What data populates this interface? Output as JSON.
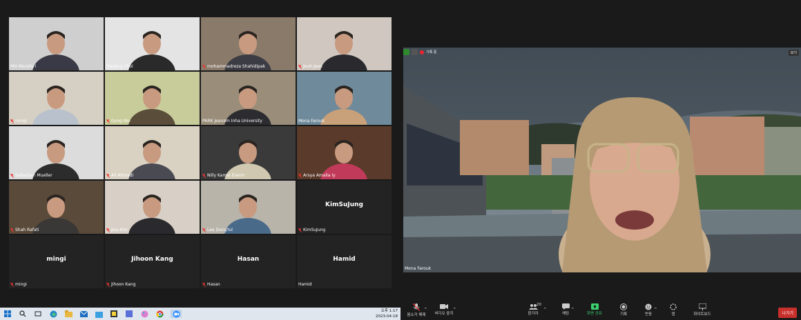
{
  "gallery": {
    "tiles": [
      {
        "name": "MH Mozafari",
        "type": "video",
        "muted": false
      },
      {
        "name": "Yunjong Choi",
        "type": "video",
        "muted": false
      },
      {
        "name": "mohammadreza Shahidipak",
        "type": "video",
        "muted": true
      },
      {
        "name": "Jeuh Jeon",
        "type": "video",
        "muted": true
      },
      {
        "name": "mingi",
        "type": "video",
        "muted": true
      },
      {
        "name": "Gong Nio",
        "type": "video",
        "muted": true
      },
      {
        "name": "PARK Jeanam Inha University",
        "type": "video",
        "muted": false
      },
      {
        "name": "Mona Farouk",
        "type": "video",
        "muted": false,
        "active": true
      },
      {
        "name": "Sebastian Mueller",
        "type": "video",
        "muted": true
      },
      {
        "name": "Ali Ahmadi",
        "type": "video",
        "muted": true
      },
      {
        "name": "Nilly Kamal Elamir",
        "type": "video",
        "muted": true
      },
      {
        "name": "Arsya Amalia Iy",
        "type": "video",
        "muted": true
      },
      {
        "name": "Shah Rafati",
        "type": "video",
        "muted": true
      },
      {
        "name": "Jisu Kim",
        "type": "video",
        "muted": true
      },
      {
        "name": "Lee DongYul",
        "type": "video",
        "muted": true
      },
      {
        "name": "KimSuJung",
        "type": "name",
        "display": "KimSuJung",
        "muted": true
      },
      {
        "name": "mingi",
        "type": "name",
        "display": "mingi",
        "muted": true
      },
      {
        "name": "Jihoon Kang",
        "type": "name",
        "display": "Jihoon Kang",
        "muted": true
      },
      {
        "name": "Hasan",
        "type": "name",
        "display": "Hasan",
        "muted": true
      },
      {
        "name": "Hamid",
        "type": "name",
        "display": "Hamid",
        "muted": false
      }
    ]
  },
  "speaker": {
    "name": "Mona Farouk",
    "top_label": "기록 중",
    "view_button": "보기"
  },
  "toolbar": {
    "mute": "음소거 해제",
    "video": "비디오 중지",
    "participants": "참가자",
    "participants_count": "20",
    "chat": "채팅",
    "share": "화면 공유",
    "record": "기록",
    "reactions": "반응",
    "apps": "앱",
    "whiteboard": "화이트보드",
    "leave": "나가기"
  },
  "taskbar": {
    "time": "오후 1:17",
    "date": "2023-04-18"
  },
  "colors": {
    "share_green": "#3bd16f",
    "leave_red": "#c8302c",
    "active_border": "#d6d63a"
  }
}
